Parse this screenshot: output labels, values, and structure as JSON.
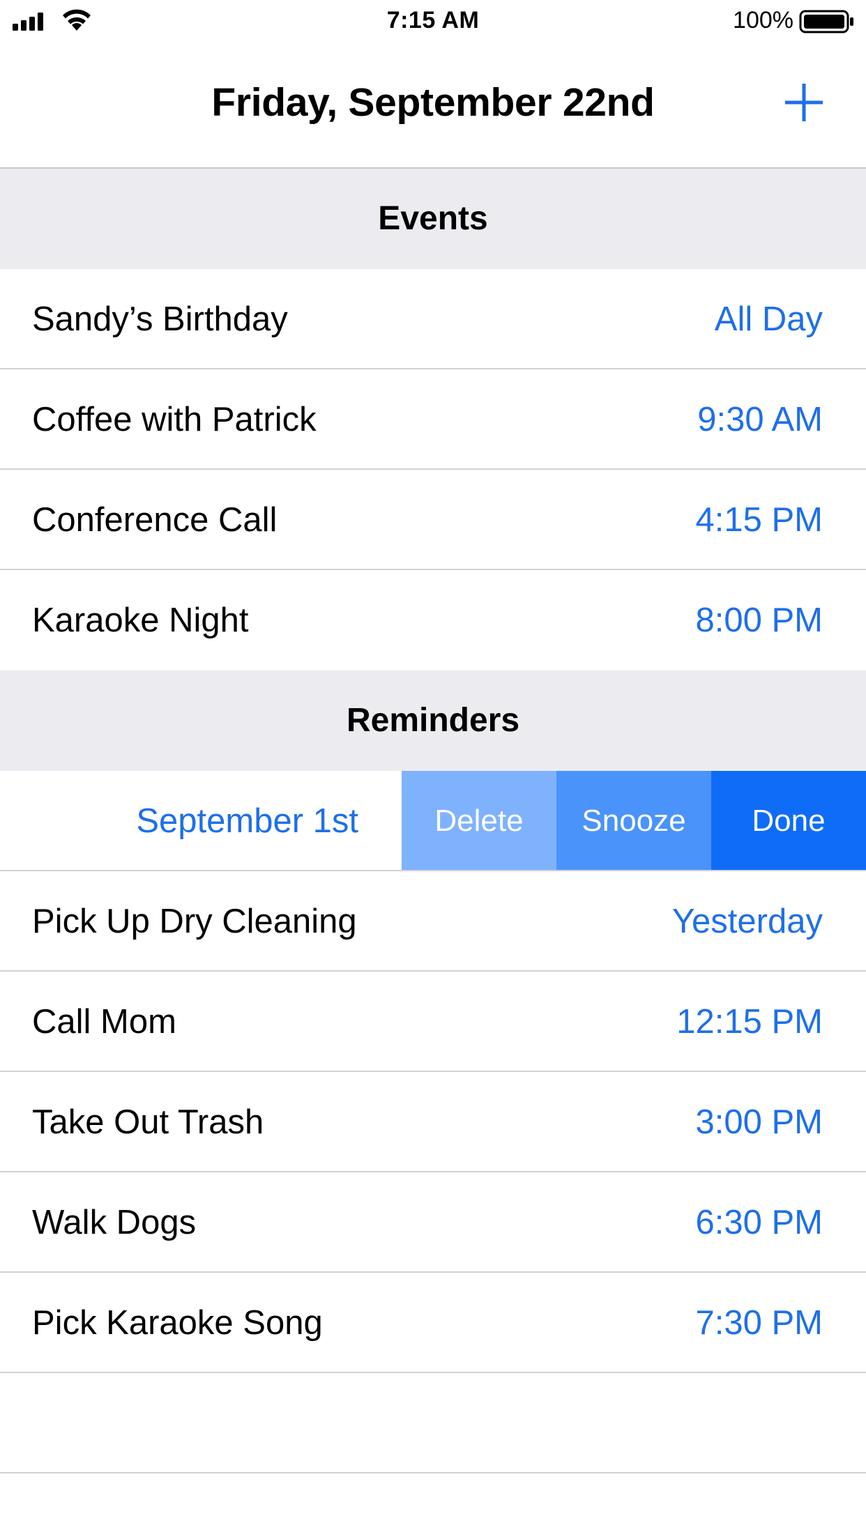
{
  "status_bar": {
    "time": "7:15 AM",
    "battery_percent": "100%",
    "signal_icon": "cellular-signal-icon",
    "wifi_icon": "wifi-icon",
    "battery_icon": "battery-icon"
  },
  "nav": {
    "title": "Friday, September 22nd",
    "add_icon": "plus-icon"
  },
  "colors": {
    "accent": "#1e6fea",
    "section_bg": "#ebebf0",
    "delete_bg": "#7fb2fc",
    "snooze_bg": "#4a93fa",
    "done_bg": "#0f6cf7"
  },
  "events": {
    "header": "Events",
    "items": [
      {
        "title": "Sandy’s Birthday",
        "time": "All Day"
      },
      {
        "title": "Coffee with Patrick",
        "time": "9:30 AM"
      },
      {
        "title": "Conference Call",
        "time": "4:15 PM"
      },
      {
        "title": "Karaoke Night",
        "time": "8:00 PM"
      }
    ]
  },
  "reminders": {
    "header": "Reminders",
    "swiped_item": {
      "time": "September 1st",
      "actions": {
        "delete": "Delete",
        "snooze": "Snooze",
        "done": "Done"
      }
    },
    "items": [
      {
        "title": "Pick Up Dry Cleaning",
        "time": "Yesterday"
      },
      {
        "title": "Call Mom",
        "time": "12:15 PM"
      },
      {
        "title": "Take Out Trash",
        "time": "3:00 PM"
      },
      {
        "title": "Walk Dogs",
        "time": "6:30 PM"
      },
      {
        "title": "Pick Karaoke Song",
        "time": "7:30 PM"
      }
    ]
  }
}
